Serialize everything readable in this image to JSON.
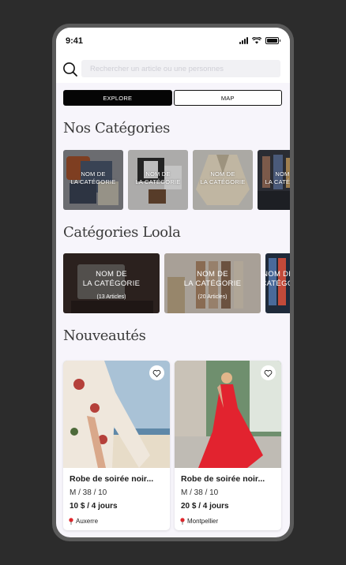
{
  "status_bar": {
    "time": "9:41"
  },
  "search": {
    "placeholder": "Rechercher un article ou une personnes"
  },
  "tabs": [
    {
      "label": "EXPLORE",
      "active": true
    },
    {
      "label": "MAP",
      "active": false
    }
  ],
  "sections": {
    "nos_categories": "Nos Catégories",
    "categories_loola": "Catégories Loola",
    "nouveautes": "Nouveautés"
  },
  "nos_categories": [
    {
      "line1": "NOM DE",
      "line2": "LA CATÉGORIE"
    },
    {
      "line1": "NOM DE",
      "line2": "LA CATÉGORIE"
    },
    {
      "line1": "NOM DE",
      "line2": "LA CATÉGORIE"
    },
    {
      "line1": "NOM DE",
      "line2": "LA CATÉGORIE"
    }
  ],
  "categories_loola": [
    {
      "line1": "NOM DE",
      "line2": "LA CATÉGORIE",
      "count": "(13 Articles)"
    },
    {
      "line1": "NOM DE",
      "line2": "LA CATÉGORIE",
      "count": "(20 Articles)"
    },
    {
      "line1": "NOM DE",
      "line2": "LA CATÉGORIE",
      "count": ""
    }
  ],
  "products": [
    {
      "name": "Robe de soirée noir...",
      "meta": "M / 38 / 10",
      "price": "10 $ / 4 jours",
      "location": "Auxerre"
    },
    {
      "name": "Robe de soirée noir...",
      "meta": "M / 38 / 10",
      "price": "20 $ / 4 jours",
      "location": "Montpellier"
    }
  ],
  "colors": {
    "accent": "#050505",
    "background": "#f7f5fb",
    "pin": "#e0262b"
  },
  "icons": {
    "search": "search-icon",
    "heart": "heart-outline-icon",
    "pin": "location-pin-icon"
  }
}
